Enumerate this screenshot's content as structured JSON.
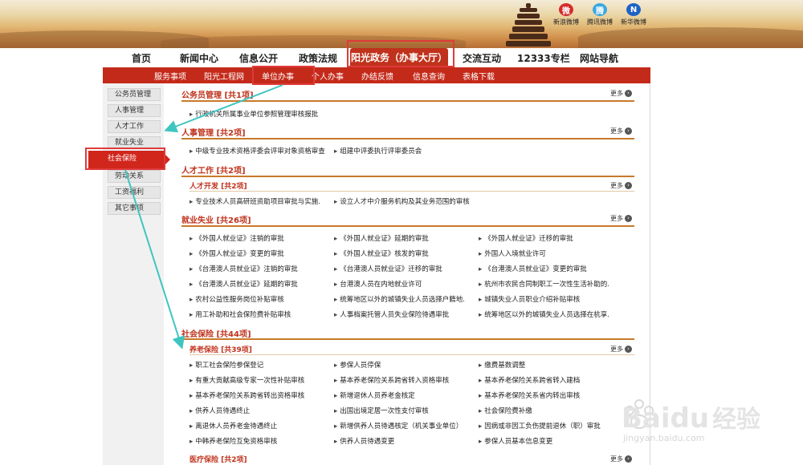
{
  "social": [
    {
      "label": "新浪微博",
      "icon": "weibo-icon",
      "color": "#d52b2b"
    },
    {
      "label": "腾讯微博",
      "icon": "tencent-weibo-icon",
      "color": "#3aa7e0"
    },
    {
      "label": "新华微博",
      "icon": "xinhua-weibo-icon",
      "color": "#1d62c6"
    }
  ],
  "nav": {
    "items": [
      "首页",
      "新闻中心",
      "信息公开",
      "政策法规",
      "交流互动",
      "12333专栏",
      "网站导航"
    ],
    "active": "阳光政务（办事大厅）"
  },
  "subnav": [
    "服务事项",
    "阳光工程网",
    "单位办事",
    "个人办事",
    "办结反馈",
    "信息查询",
    "表格下载"
  ],
  "sidebar": {
    "items": [
      "公务员管理",
      "人事管理",
      "人才工作",
      "就业失业",
      "社会保险",
      "劳动关系",
      "工资福利",
      "其它事项"
    ],
    "active_index": 4
  },
  "more_label": "更多",
  "sections": [
    {
      "title": "公务员管理 [共1项]",
      "items": [
        "行政机关所属事业单位参照管理审核报批"
      ]
    },
    {
      "title": "人事管理 [共2项]",
      "items": [
        "中级专业技术资格评委会评审对象资格审查",
        "组建中评委执行评审委员会"
      ]
    },
    {
      "title": "人才工作 [共2项]",
      "sub": "人才开发 [共2项]",
      "items": [
        "专业技术人员高研班资助项目审批与实施.",
        "设立人才中介服务机构及其业务范围的审核"
      ]
    },
    {
      "title": "就业失业 [共26项]",
      "items": [
        "《外国人就业证》注销的审批",
        "《外国人就业证》延期的审批",
        "《外国人就业证》迁移的审批",
        "《外国人就业证》变更的审批",
        "《外国人就业证》核发的审批",
        "外国人入境就业许可",
        "《台港澳人员就业证》注销的审批",
        "《台港澳人员就业证》迁移的审批",
        "《台港澳人员就业证》变更的审批",
        "《台港澳人员就业证》延期的审批",
        "台港澳人员在内地就业许可",
        "杭州市农民合同制职工一次性生活补助的.",
        "农村公益性服务岗位补贴审核",
        "统筹地区以外的城镇失业人员选择户籍地.",
        "城镇失业人员职业介绍补贴审核",
        "用工补助和社会保险费补贴审核",
        "人事档案托管人员失业保险待遇审批",
        "统筹地区以外的城镇失业人员选择在杭享."
      ]
    },
    {
      "title": "社会保险 [共44项]",
      "sub": "养老保险 [共39项]",
      "items": [
        "职工社会保险参保登记",
        "参保人员停保",
        "缴费基数调整",
        "有重大贡献高级专家一次性补贴审核",
        "基本养老保险关系跨省转入资格审核",
        "基本养老保险关系跨省转入建档",
        "基本养老保险关系跨省转出资格审核",
        "新增退休人员养老金核定",
        "基本养老保险关系省内转出审核",
        "供养人员待遇终止",
        "出国出境定居一次性支付审核",
        "社会保险费补缴",
        "离退休人员养老金待遇终止",
        "新增供养人员待遇核定（机关事业单位）",
        "因病或非因工负伤提前退休（职）审批",
        "中韩养老保险互免资格审核",
        "供养人员待遇变更",
        "参保人员基本信息变更"
      ],
      "sub2": "医疗保险 [共2项]"
    }
  ],
  "watermark": {
    "brand": "Bai",
    "brand2": "du",
    "cn": "经验",
    "url": "jingyan.baidu.com"
  }
}
